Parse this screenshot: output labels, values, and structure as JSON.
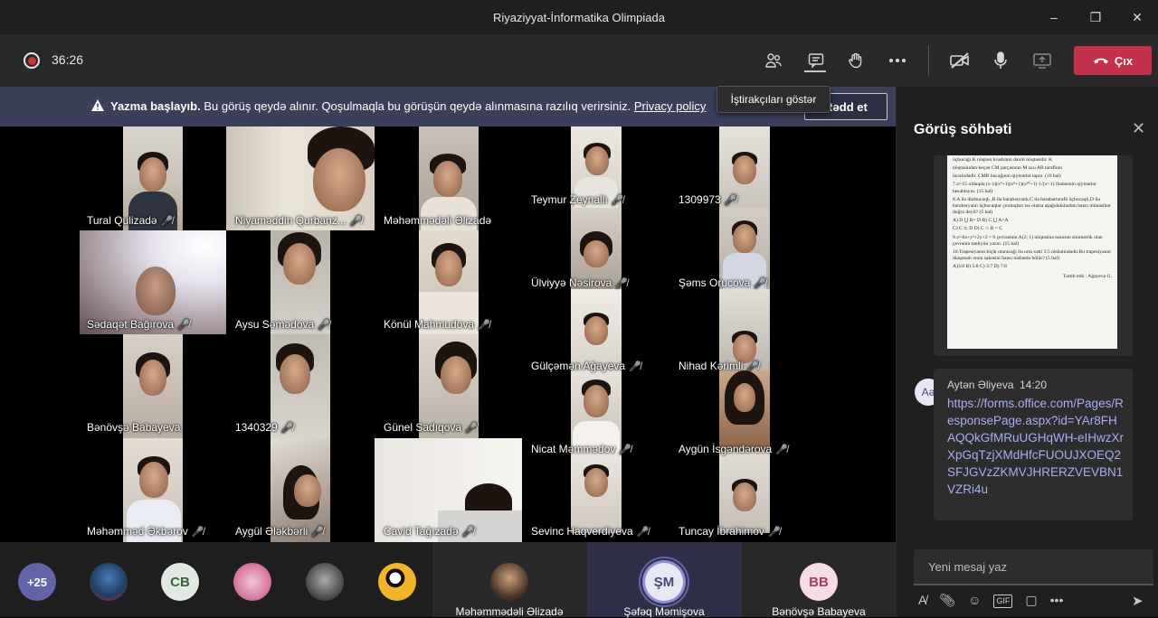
{
  "window": {
    "title": "Riyaziyyat-İnformatika Olimpiada",
    "controls": [
      "–",
      "❐",
      "✕"
    ]
  },
  "toolbar": {
    "timer": "36:26",
    "leave_label": "Çıx",
    "tooltip": "İştirakçıları göstər"
  },
  "banner": {
    "bold": "Yazma başlayıb.",
    "text": "Bu görüş qeydə alınır. Qoşulmaqla bu görüşün qeydə alınmasına razılıq verirsiniz.",
    "link": "Privacy policy",
    "reject_label": "Rədd et"
  },
  "tiles": [
    {
      "name": "Tural Qulizadə"
    },
    {
      "name": "Niyaməddin Qurbanz..."
    },
    {
      "name": "Məhəmmədəli Əlizadə"
    },
    {
      "name": "Teymur Zeynallı"
    },
    {
      "name": "1309973"
    },
    {
      "name": "Sədaqət Bağırova"
    },
    {
      "name": "Aysu Səmədova"
    },
    {
      "name": "Könül Mahmudova"
    },
    {
      "name": "Ülviyyə Nəsirova"
    },
    {
      "name": "Şəms Orucova"
    },
    {
      "name": "Gülçəmən Ağayeva"
    },
    {
      "name": "Nihad Kərimli"
    },
    {
      "name": "Bənövşə Babayeva"
    },
    {
      "name": "1340329"
    },
    {
      "name": "Günel Sadıqova"
    },
    {
      "name": "Nicat Məmmədov"
    },
    {
      "name": "Aygün İsgəndərova"
    },
    {
      "name": "Məhəmməd Əkbərov"
    },
    {
      "name": "Aygül Ələkbərli"
    },
    {
      "name": "Cavid Tağızadə"
    },
    {
      "name": "Sevinc Haqverdiyeva"
    },
    {
      "name": "Tuncay İbrahimov"
    }
  ],
  "strip": {
    "overflow_count": "+25",
    "cb_initials": "CB",
    "featured": [
      {
        "name": "Məhəmmədəli Əlizadə"
      },
      {
        "name": "Şəfəq Məmişova",
        "initials": "ŞM"
      },
      {
        "name": "Bənövşə Babayeva",
        "initials": "BB"
      }
    ]
  },
  "chat": {
    "title": "Görüş söhbəti",
    "doc_lines": [
      "üçbucağı.K nöqtəsi kvadratın daxili nöqtəsidir. K",
      "nöqtəsindən keçən CM parçasının M ucu AB tərəfinin",
      "üzərindədir. CMB bucağının qiymətini tapın.     (10 bal)",
      "7.x²-15 olduqda (x-1)(x⁹+1)(x⁸+1)(x¹⁰+1)·1/(x²-1) ifadəsinin qiymətini hesablayın.   (15 bal)",
      "8.A ilə düzbucaqlı ,B ilə bərabəryanlı,C ilə bərabərtərəfli üçbucaqlı,D ilə bərabəryanlı üçbucaqlar çoxluqları isə olarsa aşağıdakılardan hansı münasibət doğru deyil?   (5 bal)",
      "A) D ⋃ B= D        B) C ⋃ A=A",
      "C) C ⊂ D           D) C ∩ B = C",
      "9.x²-6x+y²+2y+3 = 9 çevrəsinin  A(2; 1) nöqtəsinə nəzərən simmetrik olan çevrənin tənliyini yazın.  (15 bal)",
      "10.Trapesiyanın kiçik oturacağı ilə orta xətti 3:5 nisbətindədir.Bu trapesiyanın diaqonalı onun sahəsini hansı nisbətdə bölür?   (5 bal)",
      "A)3:8   B) 5:8   C) 3:7   D) 7:8",
      "Tərtib etdi :   Ağayeva G."
    ],
    "message": {
      "avatar_initials": "Aə",
      "author": "Aytən Əliyeva",
      "time": "14:20",
      "link": "https://forms.office.com/Pages/ResponsePage.aspx?id=YAr8FHAQQkGfMRuUGHqWH-eIHwzXrXpGqTzjXMdHfcFUOUJXOEQ2SFJGVzZKMVJHRERZVEVBN1VZRi4u"
    },
    "compose_placeholder": "Yeni mesaj yaz"
  },
  "colors": {
    "leave_button": "#c4314b",
    "banner": "#3c3f59",
    "accent": "#a8aef8"
  }
}
